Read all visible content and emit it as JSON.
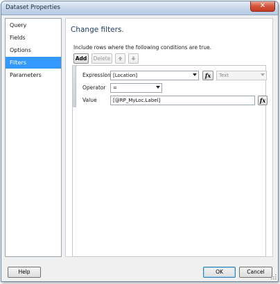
{
  "window": {
    "title": "Dataset Properties",
    "close_label": "✕"
  },
  "nav": {
    "items": [
      {
        "label": "Query"
      },
      {
        "label": "Fields"
      },
      {
        "label": "Options"
      },
      {
        "label": "Filters"
      },
      {
        "label": "Parameters"
      }
    ],
    "selected": "Filters"
  },
  "content": {
    "heading": "Change filters.",
    "subheading": "Include rows where the following conditions are true."
  },
  "toolbar": {
    "add_label": "Add",
    "delete_label": "Delete",
    "move_up_icon": "arrow-up-icon",
    "move_down_icon": "arrow-down-icon"
  },
  "filter": {
    "expression_label": "Expression",
    "expression_value": "[Location]",
    "type_value": "Text",
    "operator_label": "Operator",
    "operator_value": "=",
    "value_label": "Value",
    "value_value": "[@RP_MyLoc.Label]",
    "fx_label": "fx"
  },
  "footer": {
    "help_label": "Help",
    "ok_label": "OK",
    "cancel_label": "Cancel"
  },
  "colors": {
    "selection": "#3399ff",
    "heading": "#1e3a5f"
  }
}
